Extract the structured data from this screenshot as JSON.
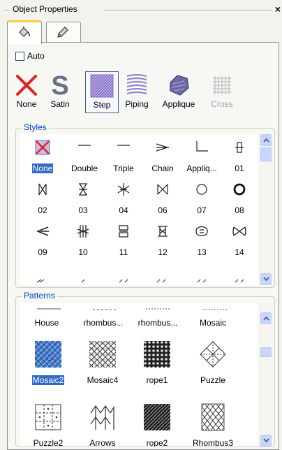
{
  "panel": {
    "title": "Object Properties",
    "close_label": "×"
  },
  "tabs": [
    {
      "name": "fill-tab",
      "icon": "paint-bucket-icon",
      "active": true
    },
    {
      "name": "outline-tab",
      "icon": "pen-icon",
      "active": false
    }
  ],
  "auto": {
    "label": "Auto",
    "checked": false
  },
  "stitch_types": [
    {
      "label": "None",
      "icon": "red-x-icon",
      "selected": false,
      "disabled": false
    },
    {
      "label": "Satin",
      "icon": "satin-s-icon",
      "selected": false,
      "disabled": false
    },
    {
      "label": "Step",
      "icon": "step-fill-icon",
      "selected": true,
      "disabled": false
    },
    {
      "label": "Piping",
      "icon": "piping-icon",
      "selected": false,
      "disabled": false
    },
    {
      "label": "Applique",
      "icon": "applique-icon",
      "selected": false,
      "disabled": false
    },
    {
      "label": "Cross",
      "icon": "cross-stitch-icon",
      "selected": false,
      "disabled": true
    }
  ],
  "styles": {
    "title": "Styles",
    "items": [
      {
        "label": "None",
        "selected": true
      },
      {
        "label": "Double"
      },
      {
        "label": "Triple"
      },
      {
        "label": "Chain"
      },
      {
        "label": "Appliq..."
      },
      {
        "label": "01"
      },
      {
        "label": "02"
      },
      {
        "label": "03"
      },
      {
        "label": "04"
      },
      {
        "label": "06"
      },
      {
        "label": "07"
      },
      {
        "label": "08"
      },
      {
        "label": "09"
      },
      {
        "label": "10"
      },
      {
        "label": "11"
      },
      {
        "label": "12"
      },
      {
        "label": "13"
      },
      {
        "label": "14"
      }
    ]
  },
  "patterns": {
    "title": "Patterns",
    "items": [
      {
        "label": "House"
      },
      {
        "label": "rhombus..."
      },
      {
        "label": "rhombus..."
      },
      {
        "label": "Mosaic"
      },
      {
        "label": "Mosaic2",
        "selected": true
      },
      {
        "label": "Mosaic4"
      },
      {
        "label": "rope1"
      },
      {
        "label": "Puzzle"
      },
      {
        "label": "Puzzle2"
      },
      {
        "label": "Arrows"
      },
      {
        "label": "rope2"
      },
      {
        "label": "Rhombus3"
      }
    ]
  },
  "colors": {
    "accent": "#316ac5",
    "tab_highlight": "#ffc73c",
    "group_title": "#0046d5",
    "none_x": "#e02020"
  }
}
